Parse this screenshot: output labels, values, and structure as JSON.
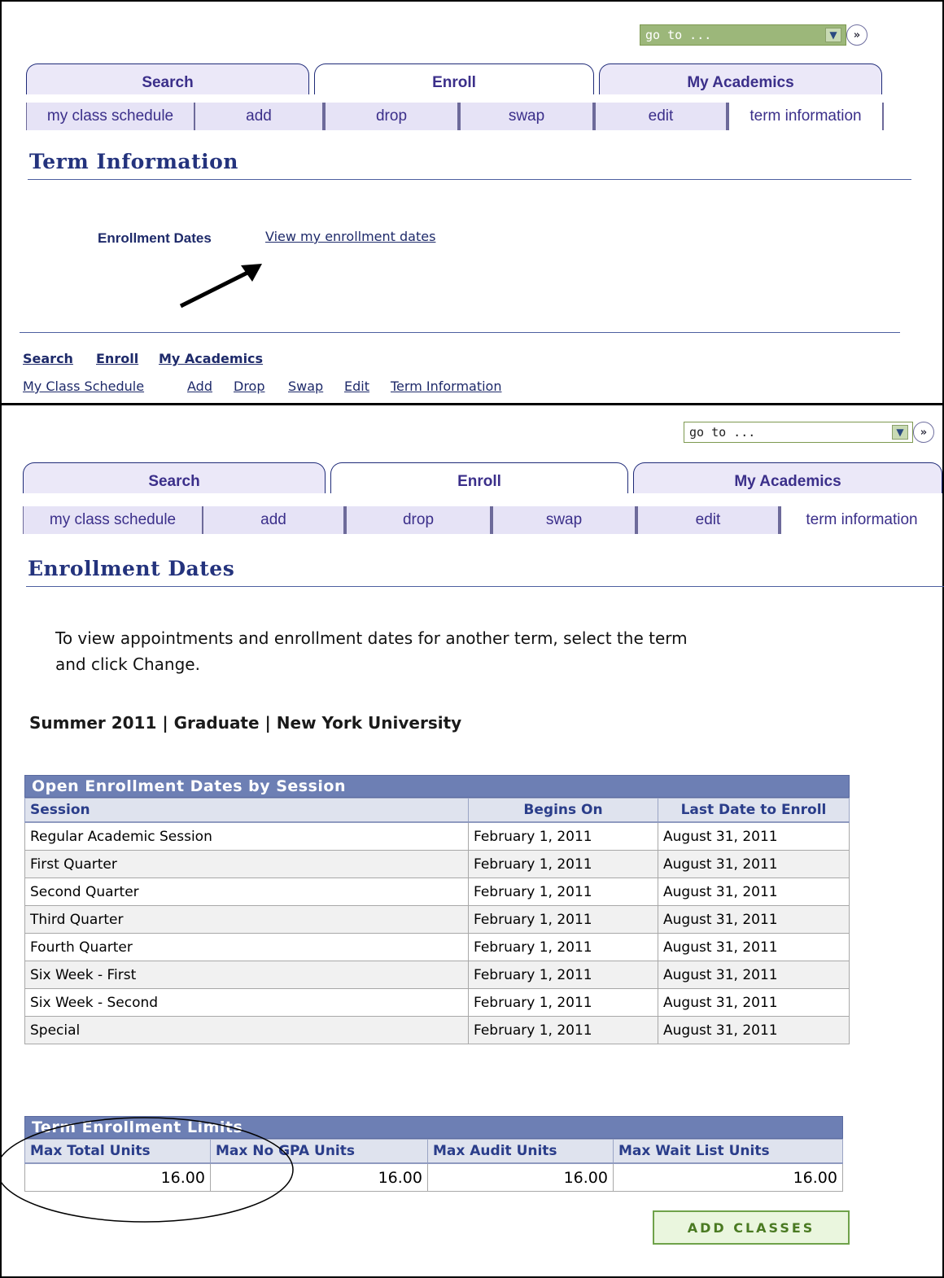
{
  "goto": {
    "placeholder": "go to ...",
    "arrow": "▼",
    "go": "»"
  },
  "tabs": [
    "Search",
    "Enroll",
    "My Academics"
  ],
  "subnav": [
    "my class schedule",
    "add",
    "drop",
    "swap",
    "edit",
    "term information"
  ],
  "top": {
    "heading": "Term Information",
    "enrollment_label": "Enrollment Dates",
    "enrollment_link": "View my enrollment dates",
    "footer_tabs": [
      "Search",
      "Enroll",
      "My Academics"
    ],
    "footer_links": [
      "My Class Schedule",
      "Add",
      "Drop",
      "Swap",
      "Edit",
      "Term Information"
    ]
  },
  "bottom": {
    "heading": "Enrollment Dates",
    "instructions_line1": "To view appointments and enrollment dates for another term, select the term",
    "instructions_line2": "and click Change.",
    "term": "Summer 2011 | Graduate | New York University",
    "sessions_table": {
      "caption": "Open Enrollment Dates by Session",
      "headers": [
        "Session",
        "Begins On",
        "Last Date to Enroll"
      ],
      "rows": [
        [
          "Regular Academic Session",
          "February 1, 2011",
          "August 31, 2011"
        ],
        [
          "First Quarter",
          "February 1, 2011",
          "August 31, 2011"
        ],
        [
          "Second Quarter",
          "February 1, 2011",
          "August 31, 2011"
        ],
        [
          "Third Quarter",
          "February 1, 2011",
          "August 31, 2011"
        ],
        [
          "Fourth Quarter",
          "February 1, 2011",
          "August 31, 2011"
        ],
        [
          "Six Week - First",
          "February 1, 2011",
          "August 31, 2011"
        ],
        [
          "Six Week - Second",
          "February 1, 2011",
          "August 31, 2011"
        ],
        [
          "Special",
          "February 1, 2011",
          "August 31, 2011"
        ]
      ]
    },
    "limits_table": {
      "caption": "Term Enrollment Limits",
      "headers": [
        "Max Total Units",
        "Max No GPA Units",
        "Max Audit Units",
        "Max Wait List Units"
      ],
      "values": [
        "16.00",
        "16.00",
        "16.00",
        "16.00"
      ]
    },
    "add_classes_button": "ADD CLASSES"
  }
}
